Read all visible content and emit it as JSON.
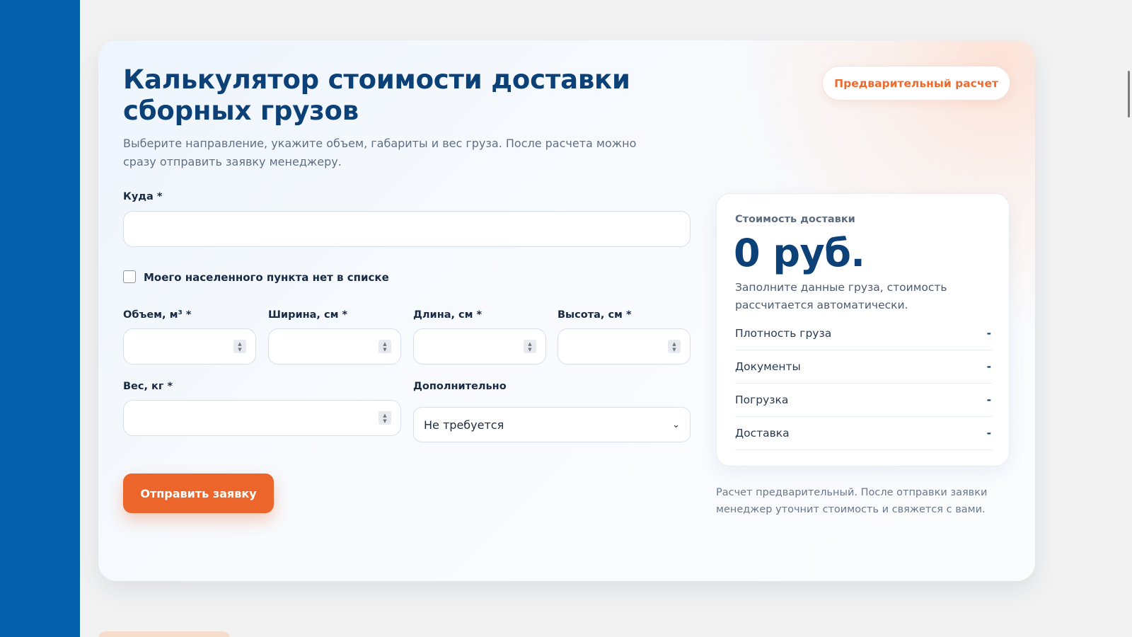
{
  "calculator": {
    "title": "Калькулятор стоимости доставки сборных грузов",
    "subtitle": "Выберите направление, укажите объем, габариты и вес груза. После расчета можно сразу отправить заявку менеджеру.",
    "badge": "Предварительный расчет",
    "destination": {
      "label": "Куда *",
      "value": ""
    },
    "not_in_list_label": "Моего населенного пункта нет в списке",
    "not_in_list_checked": false,
    "volume": {
      "label": "Объем, м³ *",
      "value": ""
    },
    "width": {
      "label": "Ширина, см *",
      "value": ""
    },
    "length": {
      "label": "Длина, см *",
      "value": ""
    },
    "height": {
      "label": "Высота, см *",
      "value": ""
    },
    "weight": {
      "label": "Вес, кг *",
      "value": ""
    },
    "extra": {
      "label": "Дополнительно",
      "selected": "Не требуется"
    },
    "submit_label": "Отправить заявку"
  },
  "result": {
    "title": "Стоимость доставки",
    "price": "0 руб.",
    "note": "Заполните данные груза, стоимость рассчитается автоматически.",
    "rows": [
      {
        "label": "Плотность груза",
        "value": "-"
      },
      {
        "label": "Документы",
        "value": "-"
      },
      {
        "label": "Погрузка",
        "value": "-"
      },
      {
        "label": "Доставка",
        "value": "-"
      }
    ],
    "footnote": "Расчет предварительный. После отправки заявки менеджер уточнит стоимость и свяжется с вами."
  },
  "colors": {
    "brand_blue": "#0460ad",
    "heading": "#0c4178",
    "accent_orange": "#ec652b"
  },
  "icons": {
    "stepper": "stepper-arrows-icon",
    "select": "chevron-down-icon"
  }
}
